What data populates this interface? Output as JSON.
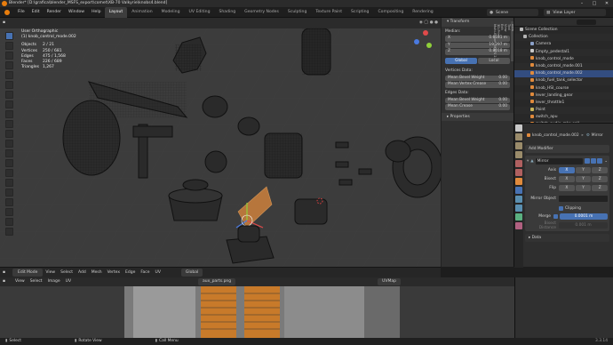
{
  "window": {
    "title": "Blender* [D:\\grafica\\blender_MSFS_export\\comet\\XB-70 Valkyrie\\knobs4.blend]",
    "controls": [
      "–",
      "□",
      "✕"
    ]
  },
  "menubar": {
    "menus": [
      "File",
      "Edit",
      "Render",
      "Window",
      "Help"
    ],
    "workspaces": [
      "Layout",
      "Animation",
      "Modeling",
      "UV Editing",
      "Shading",
      "Geometry Nodes",
      "Sculpting",
      "Texture Paint",
      "Scripting",
      "Compositing",
      "Rendering"
    ],
    "active_workspace": "Layout",
    "scene": "Scene",
    "view_layer": "View Layer"
  },
  "viewport": {
    "view": "User Orthographic",
    "object": "(1) knob_control_mode.002",
    "stats": [
      {
        "label": "Objects",
        "value": "2 / 21"
      },
      {
        "label": "Vertices",
        "value": "250 / 681"
      },
      {
        "label": "Edges",
        "value": "475 / 1,568"
      },
      {
        "label": "Faces",
        "value": "226 / 689"
      },
      {
        "label": "Triangles",
        "value": "1,267"
      }
    ],
    "header": [
      "View",
      "Select",
      "Add",
      "Mesh",
      "Vertex",
      "Edge",
      "Face",
      "UV"
    ],
    "footer_mode": "Edit Mode",
    "orientation": "Global"
  },
  "npanel": {
    "section": "Transform",
    "median_label": "Median:",
    "x": {
      "label": "X",
      "value": "0.6181 m"
    },
    "y": {
      "label": "Y",
      "value": "19.297 m"
    },
    "z": {
      "label": "Z",
      "value": "0.8018 m"
    },
    "toggle": [
      "Global",
      "Local"
    ],
    "vertices_data": "Vertices Data:",
    "vertex_fields": [
      {
        "label": "Mean Bevel Weight",
        "value": "0.00"
      },
      {
        "label": "Mean Vertex Crease",
        "value": "0.00"
      }
    ],
    "edges_data": "Edges Data:",
    "edge_fields": [
      {
        "label": "Mean Bevel Weight",
        "value": "0.00"
      },
      {
        "label": "Mean Crease",
        "value": "0.00"
      }
    ],
    "properties_label": "Properties",
    "tabs": [
      "Item",
      "Tool",
      "View",
      "Edit",
      "3D-Print",
      "Multi-Export (MSFS 2..."
    ]
  },
  "outliner": {
    "root": "Scene Collection",
    "items": [
      {
        "name": "Collection",
        "color": "#b4b4b4"
      },
      {
        "name": "Camera",
        "color": "#8aa0c8"
      },
      {
        "name": "Empty_pedestal1",
        "color": "#c8c8c8"
      },
      {
        "name": "knob_control_mode",
        "color": "#e08a3c"
      },
      {
        "name": "knob_control_mode.001",
        "color": "#e08a3c"
      },
      {
        "name": "knob_control_mode.002",
        "color": "#e08a3c",
        "selected": true
      },
      {
        "name": "knob_fuel_tank_selector",
        "color": "#e08a3c"
      },
      {
        "name": "knob_HSI_course",
        "color": "#e08a3c"
      },
      {
        "name": "lever_landing_gear",
        "color": "#e08a3c"
      },
      {
        "name": "lever_throttle1",
        "color": "#e08a3c"
      },
      {
        "name": "Point",
        "color": "#c8b45a"
      },
      {
        "name": "switch_apu",
        "color": "#e08a3c"
      },
      {
        "name": "switch_audio_mkr_sell",
        "color": "#e08a3c"
      },
      {
        "name": "switch_body1.002",
        "color": "#e08a3c"
      }
    ]
  },
  "properties": {
    "object": "knob_control_mode.002",
    "modifier_tab": "Mirror",
    "add_modifier": "Add Modifier",
    "modifier_name": "Mirror",
    "axis_label": "Axis",
    "bisect_label": "Bisect",
    "flip_label": "Flip",
    "axes": [
      "X",
      "Y",
      "Z"
    ],
    "mirror_object": "Mirror Object",
    "clipping": "Clipping",
    "merge_label": "Merge",
    "merge_value": "0.0001 m",
    "bisect_distance": "Bisect Distance",
    "bisect_distance_value": "0.001 m",
    "data_label": "Data"
  },
  "uv": {
    "header": [
      "View",
      "Select",
      "Image",
      "UV"
    ],
    "image": "aux_parts.png",
    "uvmap": "UVMap"
  },
  "status": {
    "select": "Select",
    "rotate": "Rotate View",
    "call_menu": "Call Menu",
    "version": "3.3.14"
  },
  "colors": {
    "accent": "#4772b3",
    "selection": "#e08a3c",
    "background": "#3c3c3c"
  }
}
